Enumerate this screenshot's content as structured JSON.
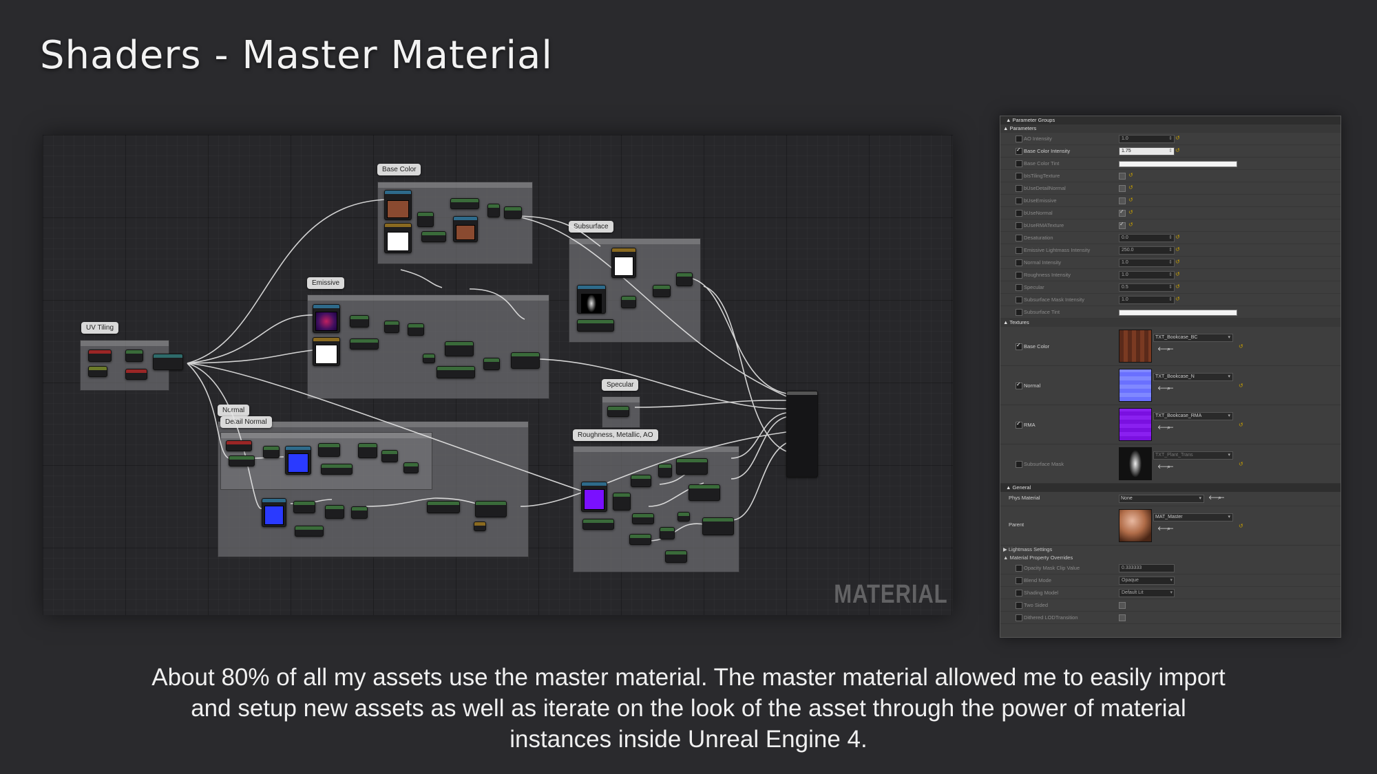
{
  "title": "Shaders - Master Material",
  "graph": {
    "comments": [
      {
        "id": "uv",
        "label": "UV Tiling",
        "inner": "UV Tiling"
      },
      {
        "id": "base",
        "label": "Base Color",
        "inner": "Base Color"
      },
      {
        "id": "sss",
        "label": "Subsurface",
        "inner": "Subsurface"
      },
      {
        "id": "emis",
        "label": "Emissive",
        "inner": "Emissive"
      },
      {
        "id": "spec",
        "label": "Specular",
        "inner": "Specular"
      },
      {
        "id": "normal",
        "label": "Normal",
        "inner": "Normal"
      },
      {
        "id": "detail",
        "label": "Detail Normal",
        "inner": "Detail Normal"
      },
      {
        "id": "rma",
        "label": "Roughness, Metallic, AO",
        "inner": "Roughness_Metallic_AO"
      }
    ],
    "watermark": "MATERIAL"
  },
  "panel": {
    "header": "Parameter Groups",
    "parameters_label": "Parameters",
    "params": [
      {
        "label": "AO Intensity",
        "checked": false,
        "value": "1.0",
        "type": "num"
      },
      {
        "label": "Base Color Intensity",
        "checked": true,
        "value": "1.75",
        "type": "num"
      },
      {
        "label": "Base Color Tint",
        "checked": false,
        "type": "color"
      },
      {
        "label": "bIsTilingTexture",
        "checked": false,
        "type": "bool",
        "bool": false
      },
      {
        "label": "bUseDetailNormal",
        "checked": false,
        "type": "bool",
        "bool": false
      },
      {
        "label": "bUseEmissive",
        "checked": false,
        "type": "bool",
        "bool": false
      },
      {
        "label": "bUseNormal",
        "checked": false,
        "type": "bool",
        "bool": true
      },
      {
        "label": "bUseRMATexture",
        "checked": false,
        "type": "bool",
        "bool": true
      },
      {
        "label": "Desaturation",
        "checked": false,
        "value": "0.0",
        "type": "num"
      },
      {
        "label": "Emissive Lightmass Intensity",
        "checked": false,
        "value": "250.0",
        "type": "num"
      },
      {
        "label": "Normal Intensity",
        "checked": false,
        "value": "1.0",
        "type": "num"
      },
      {
        "label": "Roughness Intensity",
        "checked": false,
        "value": "1.0",
        "type": "num"
      },
      {
        "label": "Specular",
        "checked": false,
        "value": "0.5",
        "type": "num"
      },
      {
        "label": "Subsurface Mask Intensity",
        "checked": false,
        "value": "1.0",
        "type": "num"
      },
      {
        "label": "Subsurface Tint",
        "checked": false,
        "type": "color"
      }
    ],
    "textures_label": "Textures",
    "textures": [
      {
        "label": "Base Color",
        "checked": true,
        "asset": "TXT_Bookcase_BC"
      },
      {
        "label": "Normal",
        "checked": true,
        "asset": "TXT_Bookcase_N"
      },
      {
        "label": "RMA",
        "checked": true,
        "asset": "TXT_Bookcase_RMA"
      },
      {
        "label": "Subsurface Mask",
        "checked": false,
        "asset": "TXT_Plant_Trans"
      }
    ],
    "general_label": "General",
    "phys_material_label": "Phys Material",
    "phys_material_value": "None",
    "parent_label": "Parent",
    "parent_value": "MAT_Master",
    "lightmass_label": "Lightmass Settings",
    "overrides_label": "Material Property Overrides",
    "overrides": [
      {
        "label": "Opacity Mask Clip Value",
        "value": "0.333333",
        "type": "text"
      },
      {
        "label": "Blend Mode",
        "value": "Opaque",
        "type": "select"
      },
      {
        "label": "Shading Model",
        "value": "Default Lit",
        "type": "select"
      },
      {
        "label": "Two Sided",
        "type": "bool"
      },
      {
        "label": "Dithered LODTransition",
        "type": "bool"
      }
    ]
  },
  "caption": "About 80% of all my assets use the master material. The master material allowed me to easily import and setup new assets as well as iterate on the look of the asset through the power of material instances inside Unreal Engine 4.",
  "colors": {
    "background": "#2a2a2d",
    "reset_arrow": "#c8a000",
    "wire": "#e6e6e6"
  }
}
